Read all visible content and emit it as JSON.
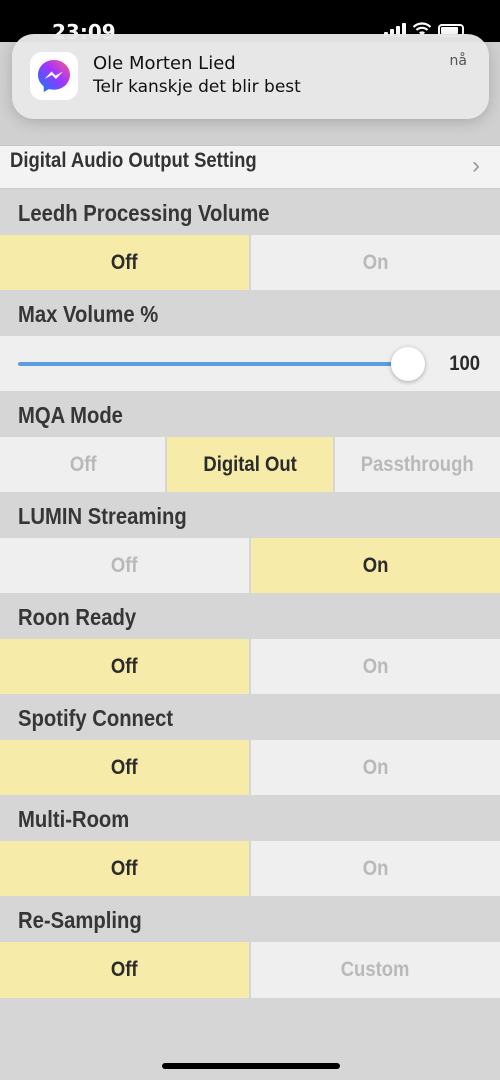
{
  "status_bar": {
    "time": "23:09"
  },
  "notification": {
    "sender": "Ole Morten Lied",
    "message": "Telr kanskje det blir best",
    "time": "nå",
    "app_icon": "messenger-icon"
  },
  "nav": {
    "digital_audio_output_label": "Digital Audio Output Setting",
    "chevron": "›"
  },
  "settings": {
    "leedh": {
      "title": "Leedh Processing Volume",
      "options": [
        "Off",
        "On"
      ],
      "selected": "Off"
    },
    "max_volume": {
      "title": "Max Volume %",
      "value": "100",
      "level_percent": 100
    },
    "mqa": {
      "title": "MQA Mode",
      "options": [
        "Off",
        "Digital Out",
        "Passthrough"
      ],
      "selected": "Digital Out"
    },
    "lumin": {
      "title": "LUMIN Streaming",
      "options": [
        "Off",
        "On"
      ],
      "selected": "On"
    },
    "roon": {
      "title": "Roon Ready",
      "options": [
        "Off",
        "On"
      ],
      "selected": "Off"
    },
    "spotify": {
      "title": "Spotify Connect",
      "options": [
        "Off",
        "On"
      ],
      "selected": "Off"
    },
    "multiroom": {
      "title": "Multi-Room",
      "options": [
        "Off",
        "On"
      ],
      "selected": "Off"
    },
    "resampling": {
      "title": "Re-Sampling",
      "options": [
        "Off",
        "Custom"
      ],
      "selected": "Off"
    }
  },
  "colors": {
    "selected_bg": "#f6eba8",
    "slider_accent": "#5b9be0"
  }
}
